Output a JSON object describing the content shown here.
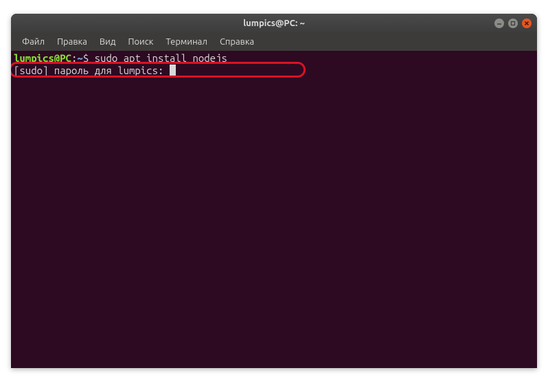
{
  "window": {
    "title": "lumpics@PC: ~"
  },
  "menubar": {
    "items": [
      {
        "label": "Файл"
      },
      {
        "label": "Правка"
      },
      {
        "label": "Вид"
      },
      {
        "label": "Поиск"
      },
      {
        "label": "Терминал"
      },
      {
        "label": "Справка"
      }
    ]
  },
  "terminal": {
    "prompt_user_host": "lumpics@PC",
    "prompt_sep": ":",
    "prompt_path": "~",
    "prompt_dollar": "$",
    "command": "sudo apt install nodejs",
    "password_prompt": "[sudo] пароль для lumpics: "
  }
}
